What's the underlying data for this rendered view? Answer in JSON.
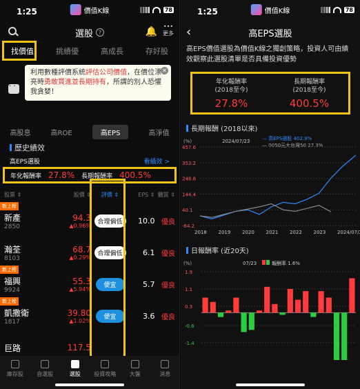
{
  "status": {
    "time": "1:25",
    "app_name": "價值K線",
    "battery": "78"
  },
  "left": {
    "header": {
      "title": "選股",
      "more": "更多"
    },
    "tabs": [
      "找價值",
      "挑績優",
      "高成長",
      "存好股"
    ],
    "banner": {
      "text_1": "利用數種評價系統",
      "text_hi_1": "評估公司價值",
      "text_2": "，在價位漂亮時",
      "text_hi_2": "勇敢買進並長期持有",
      "text_3": "，所謂的別人恐懼我貪婪！"
    },
    "subtabs": [
      "高股息",
      "高ROE",
      "高EPS",
      "高淨值"
    ],
    "history": {
      "title": "歷史績效",
      "strategy": "高EPS選股",
      "link": "看績效 >",
      "annual_label": "年化報酬率",
      "annual_value": "27.8%",
      "long_label": "長期報酬率",
      "long_value": "400.5%"
    },
    "table": {
      "headers": {
        "name": "股票 ⇕",
        "price": "股價 ⇕",
        "eval": "評價 ⇕",
        "eps": "EPS ⇕",
        "health": "體質 ⇕"
      },
      "rows": [
        {
          "badge": "新上榜",
          "name": "新產",
          "code": "2850",
          "price": "94.3",
          "change": "▲0.96%",
          "eval": "合理偏低",
          "eval_style": "white",
          "eps": "10.0",
          "health": "優良"
        },
        {
          "badge": "",
          "name": "瀚荃",
          "code": "8103",
          "price": "68.7",
          "change": "▲0.29%",
          "eval": "合理偏低",
          "eval_style": "white",
          "eps": "6.1",
          "health": "優良"
        },
        {
          "badge": "新上榜",
          "name": "福興",
          "code": "9924",
          "price": "55.3",
          "change": "▲5.94%",
          "eval": "便宜",
          "eval_style": "blue",
          "eps": "5.7",
          "health": "優良"
        },
        {
          "badge": "新上榜",
          "name": "凱撒衛",
          "code": "1817",
          "price": "39.80",
          "change": "▲1.02%",
          "eval": "便宜",
          "eval_style": "blue",
          "eps": "3.6",
          "health": "優良"
        },
        {
          "badge": "",
          "name": "巨路",
          "code": "",
          "price": "117.5",
          "change": "",
          "eval": "",
          "eval_style": "blue",
          "eps": "",
          "health": ""
        }
      ]
    },
    "nav": [
      "庫存股",
      "自選股",
      "選股",
      "投資攻略",
      "大盤",
      "消息"
    ]
  },
  "right": {
    "header": {
      "title": "高EPS選股"
    },
    "intro": "高EPS價值選股為價值K線之獨創策略，投資人可由績效觀察此選股清單是否具備投資優勢",
    "kpis": [
      {
        "label": "年化報酬率",
        "sub": "(2018至今)",
        "value": "27.8%"
      },
      {
        "label": "長期報酬率",
        "sub": "(2018至今)",
        "value": "400.5%"
      }
    ],
    "chart1": {
      "title": "長期報酬 (2018以來)",
      "unit": "(%)",
      "date": "2024/07/23",
      "legend_1": "— 高EPS選股 402.9%",
      "legend_2": "— 0050元大台灣50 27.3%"
    },
    "chart2": {
      "title": "日報酬率 (近20天)",
      "unit": "(%)",
      "date": "07/23",
      "legend": "報酬率 1.6%"
    }
  },
  "chart_data": [
    {
      "type": "line",
      "title": "長期報酬 (2018以來)",
      "ylabel": "(%)",
      "x_ticks": [
        "2018",
        "2019",
        "2020",
        "2021",
        "2022",
        "2023",
        "2024/07/23"
      ],
      "y_ticks": [
        457.6,
        353.2,
        248.8,
        144.4,
        40.1,
        -64.2
      ],
      "ylim": [
        -64.2,
        457.6
      ],
      "series": [
        {
          "name": "高EPS選股",
          "color": "#2e8bff",
          "x": [
            0,
            0.5,
            1,
            1.5,
            2,
            2.5,
            3,
            3.5,
            4,
            4.5,
            5,
            5.5,
            6,
            6.55
          ],
          "values": [
            0,
            -20,
            5,
            30,
            40,
            10,
            60,
            90,
            80,
            110,
            150,
            250,
            330,
            402.9
          ]
        },
        {
          "name": "0050元大台灣50",
          "color": "#888888",
          "x": [
            0,
            0.5,
            1,
            1.5,
            2,
            2.5,
            3,
            3.5,
            4,
            4.5,
            5,
            5.5
          ],
          "values": [
            0,
            -10,
            10,
            30,
            45,
            60,
            80,
            40,
            30,
            50,
            70,
            27.3
          ]
        }
      ]
    },
    {
      "type": "bar",
      "title": "日報酬率 (近20天)",
      "ylabel": "(%)",
      "y_ticks": [
        1.9,
        1.1,
        0.3,
        -0.6,
        -1.4
      ],
      "ylim": [
        -2.2,
        1.9
      ],
      "values": [
        0.7,
        0.5,
        -0.2,
        0.1,
        0.7,
        -0.9,
        -0.8,
        0.1,
        1.2,
        0.4,
        -0.1,
        1.1,
        0.6,
        1.0,
        -0.2,
        1.0,
        0.7,
        -2.2,
        -2.2,
        1.6
      ]
    }
  ]
}
